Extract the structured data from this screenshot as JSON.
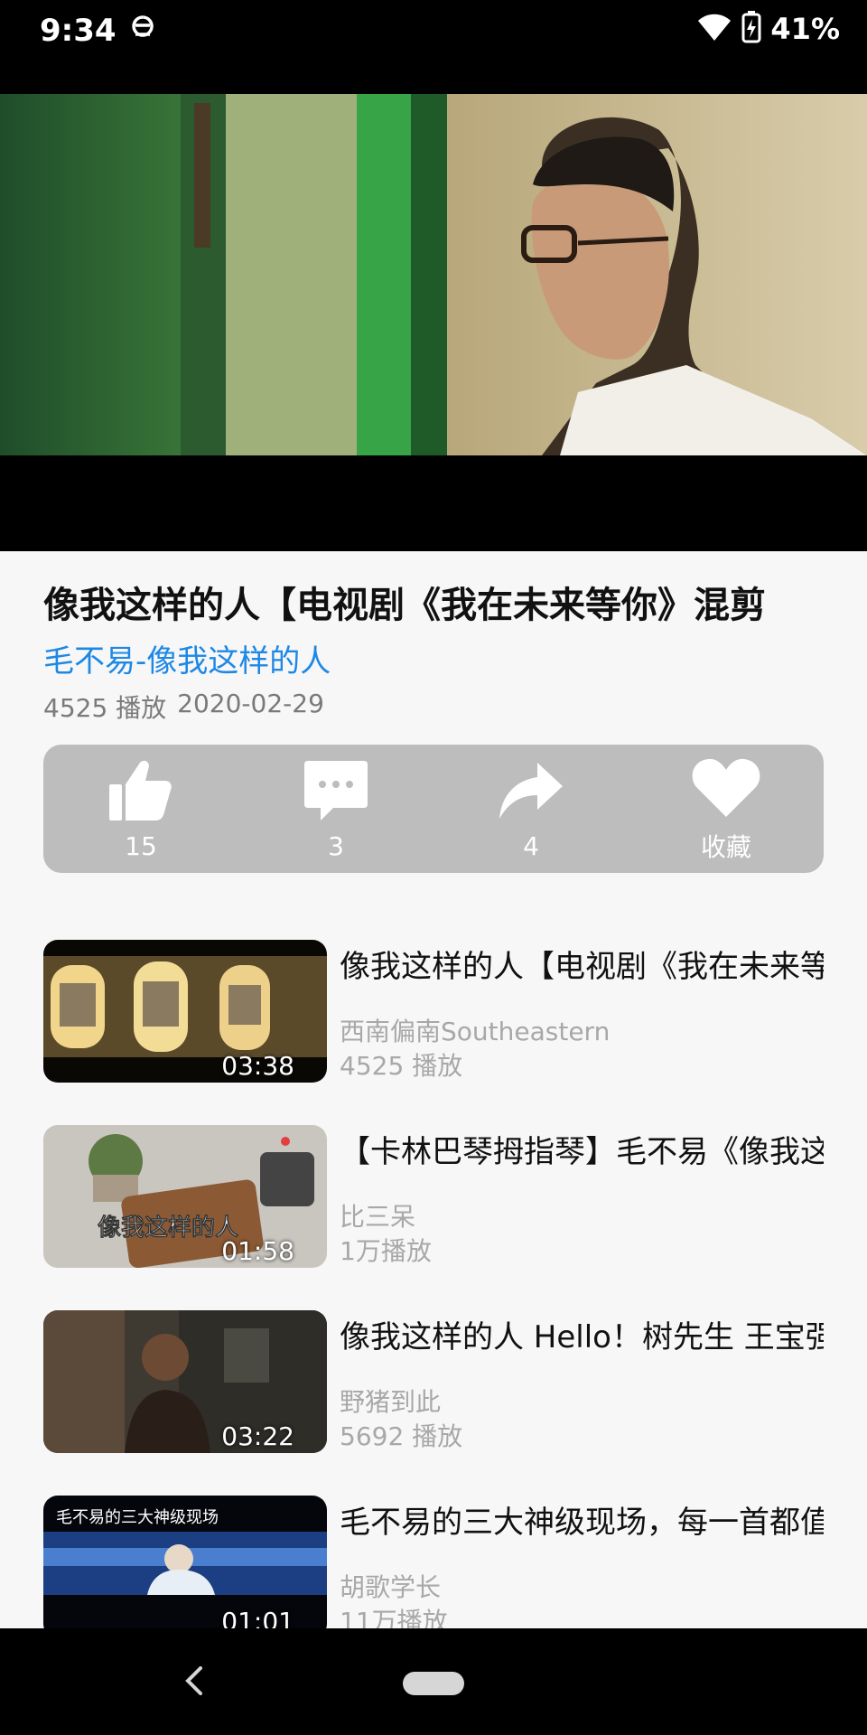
{
  "status_bar": {
    "time": "9:34",
    "battery": "41%"
  },
  "video": {
    "title": "像我这样的人【电视剧《我在未来等你》混剪",
    "source": "毛不易-像我这样的人",
    "plays": "4525 播放",
    "date": "2020-02-29"
  },
  "actions": [
    {
      "icon": "thumbs-up-icon",
      "label": "15"
    },
    {
      "icon": "comment-icon",
      "label": "3"
    },
    {
      "icon": "share-icon",
      "label": "4"
    },
    {
      "icon": "heart-icon",
      "label": "收藏"
    }
  ],
  "related": [
    {
      "title": "像我这样的人【电视剧《我在未来等你》混剪",
      "author": "西南偏南Southeastern",
      "plays": "4525 播放",
      "duration": "03:38"
    },
    {
      "title": "【卡林巴琴拇指琴】毛不易《像我这样的人》",
      "author": "比三呆",
      "plays": "1万播放",
      "duration": "01:58",
      "thumb_text": "像我这样的人"
    },
    {
      "title": "像我这样的人 Hello！树先生 王宝强",
      "author": "野猪到此",
      "plays": "5692 播放",
      "duration": "03:22"
    },
    {
      "title": "毛不易的三大神级现场，每一首都值得",
      "author": "胡歌学长",
      "plays": "11万播放",
      "duration": "01:01",
      "thumb_text": "毛不易的三大神级现场"
    }
  ],
  "colors": {
    "accent": "#1e88e5",
    "action_bar": "#bdbdbd"
  }
}
